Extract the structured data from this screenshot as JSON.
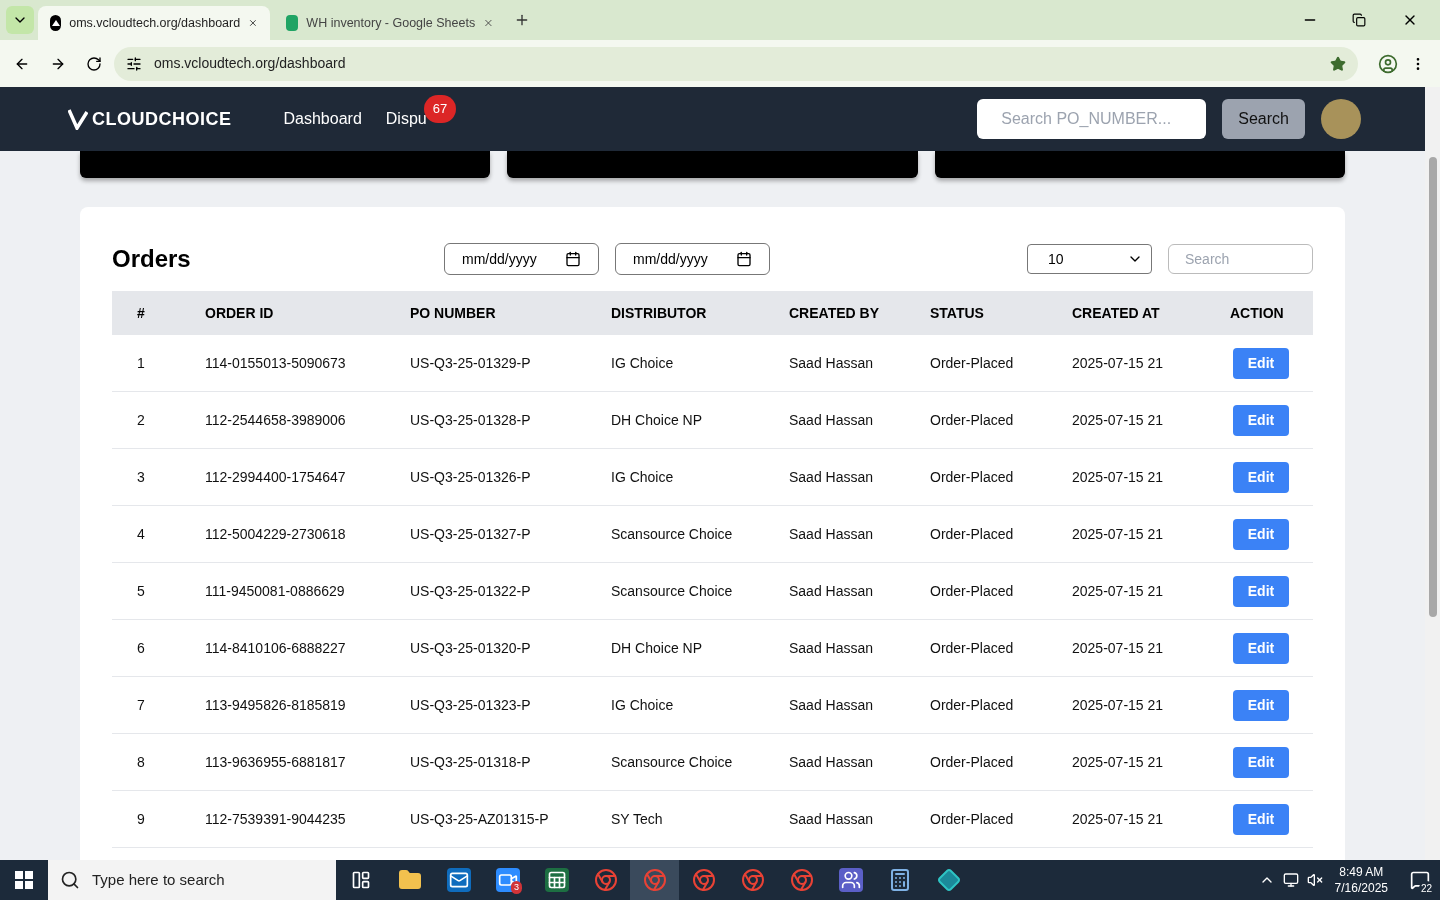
{
  "browser": {
    "tabs": [
      {
        "title": "oms.vcloudtech.org/dashboard",
        "selected": true,
        "kind": "site"
      },
      {
        "title": "WH inventory - Google Sheets",
        "selected": false,
        "kind": "sheets"
      }
    ],
    "url": "oms.vcloudtech.org/dashboard",
    "bookmarked": true
  },
  "nav": {
    "logo": "CLOUDCHOICE",
    "links": [
      {
        "label": "Dashboard"
      },
      {
        "label": "Dispu",
        "badge": "67"
      }
    ],
    "search": {
      "placeholder": "Search PO_NUMBER..."
    },
    "search_button": "Search"
  },
  "orders": {
    "title": "Orders",
    "date_from": {
      "placeholder": "mm/dd/yyyy"
    },
    "date_to": {
      "placeholder": "mm/dd/yyyy"
    },
    "page_size": "10",
    "search": {
      "placeholder": "Search"
    },
    "columns": [
      "#",
      "ORDER ID",
      "PO NUMBER",
      "DISTRIBUTOR",
      "CREATED BY",
      "STATUS",
      "CREATED AT",
      "ACTION"
    ],
    "rows": [
      {
        "cells": [
          "1",
          "114-0155013-5090673",
          "US-Q3-25-01329-P",
          "IG Choice",
          "Saad Hassan",
          "Order-Placed",
          "2025-07-15 21"
        ],
        "action": "Edit"
      },
      {
        "cells": [
          "2",
          "112-2544658-3989006",
          "US-Q3-25-01328-P",
          "DH Choice NP",
          "Saad Hassan",
          "Order-Placed",
          "2025-07-15 21"
        ],
        "action": "Edit"
      },
      {
        "cells": [
          "3",
          "112-2994400-1754647",
          "US-Q3-25-01326-P",
          "IG Choice",
          "Saad Hassan",
          "Order-Placed",
          "2025-07-15 21"
        ],
        "action": "Edit"
      },
      {
        "cells": [
          "4",
          "112-5004229-2730618",
          "US-Q3-25-01327-P",
          "Scansource Choice",
          "Saad Hassan",
          "Order-Placed",
          "2025-07-15 21"
        ],
        "action": "Edit"
      },
      {
        "cells": [
          "5",
          "111-9450081-0886629",
          "US-Q3-25-01322-P",
          "Scansource Choice",
          "Saad Hassan",
          "Order-Placed",
          "2025-07-15 21"
        ],
        "action": "Edit"
      },
      {
        "cells": [
          "6",
          "114-8410106-6888227",
          "US-Q3-25-01320-P",
          "DH Choice NP",
          "Saad Hassan",
          "Order-Placed",
          "2025-07-15 21"
        ],
        "action": "Edit"
      },
      {
        "cells": [
          "7",
          "113-9495826-8185819",
          "US-Q3-25-01323-P",
          "IG Choice",
          "Saad Hassan",
          "Order-Placed",
          "2025-07-15 21"
        ],
        "action": "Edit"
      },
      {
        "cells": [
          "8",
          "113-9636955-6881817",
          "US-Q3-25-01318-P",
          "Scansource Choice",
          "Saad Hassan",
          "Order-Placed",
          "2025-07-15 21"
        ],
        "action": "Edit"
      },
      {
        "cells": [
          "9",
          "112-7539391-9044235",
          "US-Q3-25-AZ01315-P",
          "SY Tech",
          "Saad Hassan",
          "Order-Placed",
          "2025-07-15 21"
        ],
        "action": "Edit"
      }
    ]
  },
  "taskbar": {
    "search": {
      "placeholder": "Type here to search"
    },
    "apps": [
      {
        "kind": "taskview",
        "active": false
      },
      {
        "kind": "folder",
        "active": false
      },
      {
        "kind": "mail",
        "active": false
      },
      {
        "kind": "video",
        "active": false,
        "badge": "3"
      },
      {
        "kind": "sheet",
        "active": false
      },
      {
        "kind": "browser",
        "active": false
      },
      {
        "kind": "browser",
        "active": true
      },
      {
        "kind": "browser",
        "active": false
      },
      {
        "kind": "browser",
        "active": false
      },
      {
        "kind": "browser",
        "active": false
      },
      {
        "kind": "teams",
        "active": false
      },
      {
        "kind": "calculator",
        "active": false
      },
      {
        "kind": "diamond",
        "active": false
      }
    ],
    "time": "8:49 AM",
    "date": "7/16/2025",
    "notifications": "22"
  }
}
